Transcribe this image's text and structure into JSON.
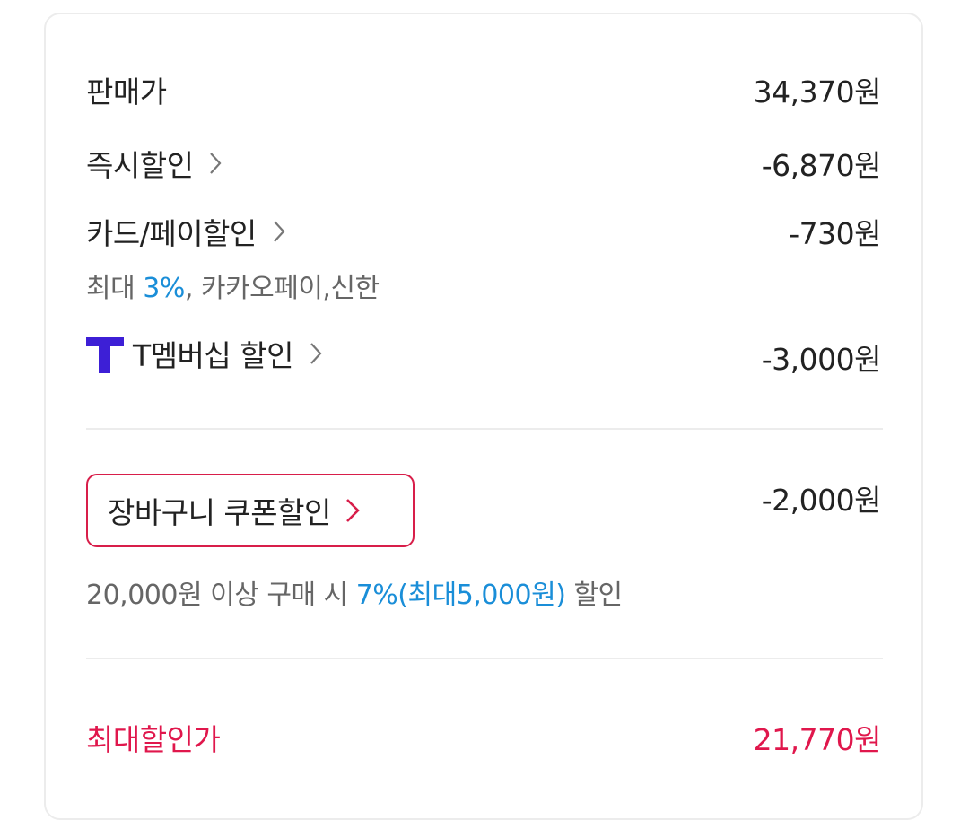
{
  "price_rows": {
    "sale_price": {
      "label": "판매가",
      "value": "34,370원"
    },
    "instant_discount": {
      "label": "즉시할인",
      "value": "-6,870원"
    },
    "card_pay_discount": {
      "label": "카드/페이할인",
      "value": "-730원",
      "sub_prefix": "최대 ",
      "sub_highlight": "3%",
      "sub_suffix": ", 카카오페이,신한"
    },
    "t_membership": {
      "label": "T멤버십 할인",
      "value": "-3,000원"
    }
  },
  "coupon": {
    "button_label": "장바구니 쿠폰할인",
    "value": "-2,000원",
    "sub_prefix": "20,000원 이상 구매 시 ",
    "sub_highlight": "7%(최대5,000원)",
    "sub_suffix": " 할인"
  },
  "max_discount": {
    "label": "최대할인가",
    "value": "21,770원"
  },
  "colors": {
    "accent_red": "#e0174c",
    "accent_blue": "#1a8ed8",
    "t_logo": "#3d1fd6"
  },
  "icons": {
    "chevron": "chevron-right-icon",
    "t_logo": "t-membership-logo"
  }
}
